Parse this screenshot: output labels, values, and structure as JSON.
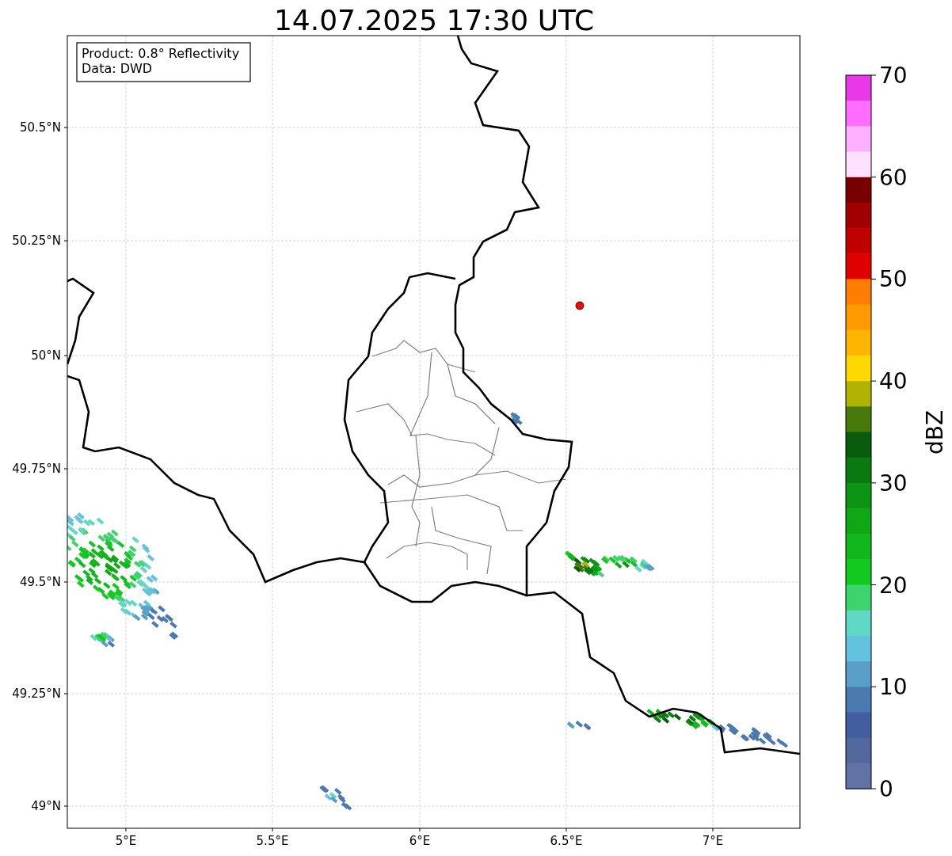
{
  "title": "14.07.2025 17:30 UTC",
  "info_box": [
    "Product: 0.8° Reflectivity",
    "Data: DWD"
  ],
  "y_ticks": [
    "50.5°N",
    "50.25°N",
    "50°N",
    "49.75°N",
    "49.5°N",
    "49.25°N",
    "49°N"
  ],
  "x_ticks": [
    "5°E",
    "5.5°E",
    "6°E",
    "6.5°E",
    "7°E"
  ],
  "colorbar": {
    "label": "dBZ",
    "ticks": [
      "70",
      "60",
      "50",
      "40",
      "30",
      "20",
      "10",
      "0"
    ],
    "segments": [
      {
        "color": "#e838e8"
      },
      {
        "color": "#ff6cff"
      },
      {
        "color": "#ffb0ff"
      },
      {
        "color": "#ffe0ff"
      },
      {
        "color": "#780000"
      },
      {
        "color": "#a00000"
      },
      {
        "color": "#c00000"
      },
      {
        "color": "#e00000"
      },
      {
        "color": "#ff7d00"
      },
      {
        "color": "#ff9a00"
      },
      {
        "color": "#ffb400"
      },
      {
        "color": "#ffd800"
      },
      {
        "color": "#b0b400"
      },
      {
        "color": "#477a0a"
      },
      {
        "color": "#085c0c"
      },
      {
        "color": "#0a7a10"
      },
      {
        "color": "#0c9414"
      },
      {
        "color": "#0ea815"
      },
      {
        "color": "#10b81b"
      },
      {
        "color": "#12c91f"
      },
      {
        "color": "#3ed46d"
      },
      {
        "color": "#5fd8c5"
      },
      {
        "color": "#63c3de"
      },
      {
        "color": "#5a9fc8"
      },
      {
        "color": "#4a7ab0"
      },
      {
        "color": "#425ea0"
      },
      {
        "color": "#53699e"
      },
      {
        "color": "#6272a4"
      }
    ]
  }
}
